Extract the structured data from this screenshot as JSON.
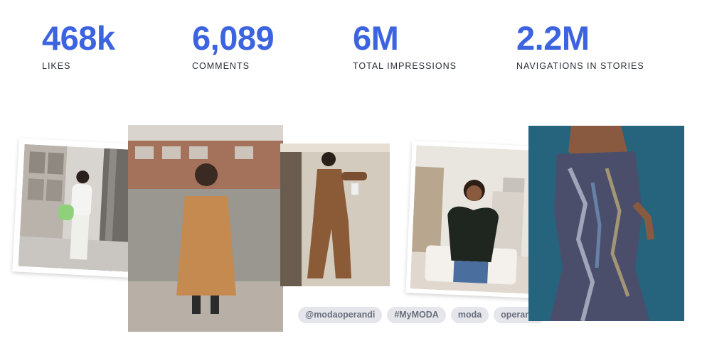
{
  "stats": [
    {
      "value": "468k",
      "label": "LIKES"
    },
    {
      "value": "6,089",
      "label": "COMMENTS"
    },
    {
      "value": "6M",
      "label": "TOTAL IMPRESSIONS"
    },
    {
      "value": "2.2M",
      "label": "NAVIGATIONS IN STORIES"
    }
  ],
  "hashtags": [
    "@modaoperandi",
    "#MyMODA",
    "moda",
    "operandi"
  ],
  "colors": {
    "accent": "#3d64e0",
    "label": "#2b2e37",
    "tag_bg": "#e4e6ec",
    "tag_text": "#6a6f7b"
  }
}
